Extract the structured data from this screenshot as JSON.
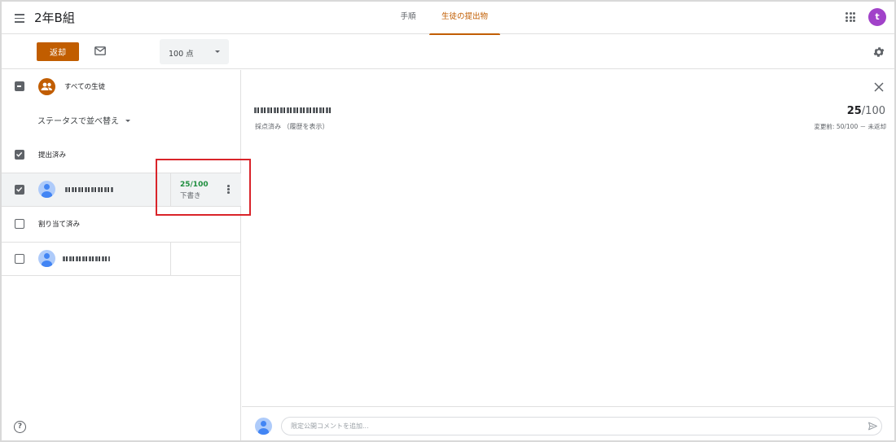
{
  "header": {
    "title": "2年B組",
    "tabs": [
      {
        "label": "手順",
        "active": false
      },
      {
        "label": "生徒の提出物",
        "active": true
      }
    ],
    "avatar_letter": "t"
  },
  "toolbar": {
    "return_label": "返却",
    "points_value": "100 点"
  },
  "left": {
    "all_students_label": "すべての生徒",
    "sort_label": "ステータスで並べ替え",
    "groups": [
      {
        "label": "提出済み",
        "students": [
          {
            "grade": "25/100",
            "status": "下書き",
            "selected": true
          }
        ]
      },
      {
        "label": "割り当て済み",
        "students": [
          {
            "grade": "",
            "status": "",
            "selected": false
          }
        ]
      }
    ]
  },
  "right": {
    "status_text": "採点済み （履歴を表示）",
    "score_num": "25",
    "score_den": "/100",
    "score_sub": "変更前: 50/100 － 未返却",
    "comment_placeholder": "限定公開コメントを追加..."
  },
  "colors": {
    "accent": "#c15d00",
    "grade_green": "#1e8e3e",
    "avatar_purple": "#a142c9",
    "highlight_red": "#d9242a"
  }
}
